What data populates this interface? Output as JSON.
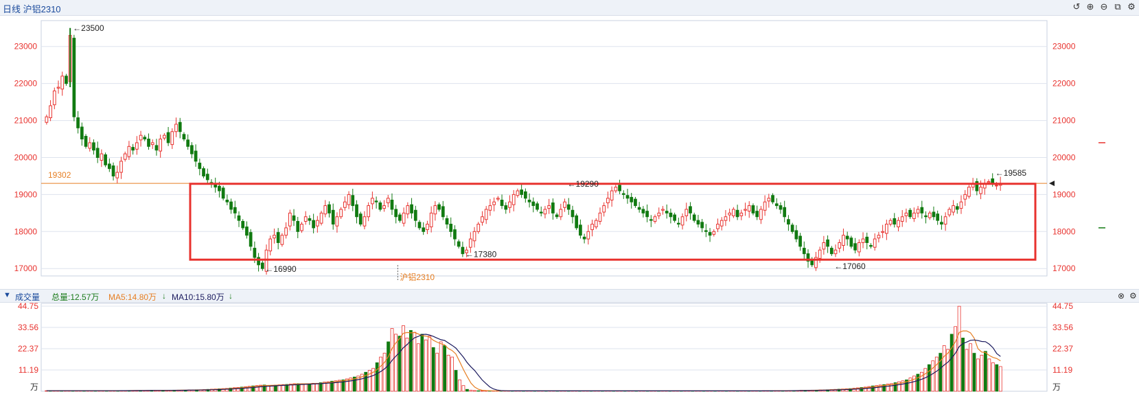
{
  "header": {
    "title": "日线 沪铝2310"
  },
  "toolbar": {
    "icons": [
      "undo-icon",
      "zoom-in-icon",
      "zoom-out-icon",
      "export-icon",
      "settings-icon"
    ]
  },
  "volume_bar": {
    "toggle_icon": "triangle-down-icon",
    "label": "成交量",
    "total": "总量:12.57万",
    "ma5": "MA5:14.80万",
    "ma10": "MA10:15.80万",
    "colors": {
      "label": "#1a4a9c",
      "total": "#1a7a1a",
      "ma5": "#e67e22",
      "ma10": "#1a1a5e"
    }
  },
  "colors": {
    "up": "#e8322e",
    "down": "#117a11",
    "axis_text": "#e8322e",
    "ref_line": "#e67e22",
    "box": "#e8322e",
    "grid": "#dde3ee"
  },
  "chart_data": [
    {
      "type": "candlestick",
      "title": "日线 沪铝2310",
      "ylim": [
        16800,
        23700
      ],
      "y_ticks": [
        17000,
        18000,
        19000,
        20000,
        21000,
        22000,
        23000
      ],
      "reference_line": {
        "value": 19302,
        "label": "19302"
      },
      "annotations": [
        {
          "label": "23500",
          "value": 23500
        },
        {
          "label": "19290",
          "value": 19290
        },
        {
          "label": "17380",
          "value": 17380
        },
        {
          "label": "16990",
          "value": 16990
        },
        {
          "label": "17060",
          "value": 17060
        },
        {
          "label": "19585",
          "value": 19585
        }
      ],
      "contract_label": "沪铝2310",
      "highlight_box": {
        "y_top": 19290,
        "y_bottom": 17240
      },
      "grid": true,
      "close_series": [
        21100,
        21400,
        21800,
        21900,
        22200,
        22000,
        23300,
        21100,
        20800,
        20500,
        20300,
        20400,
        20200,
        20000,
        20100,
        19800,
        19700,
        19500,
        19600,
        19900,
        20100,
        20300,
        20200,
        20400,
        20600,
        20500,
        20300,
        20400,
        20200,
        20500,
        20600,
        20400,
        20700,
        20900,
        20700,
        20500,
        20300,
        20100,
        19900,
        19700,
        19500,
        19400,
        19300,
        19200,
        19100,
        18900,
        18800,
        18600,
        18500,
        18300,
        18100,
        17900,
        17600,
        17300,
        17100,
        17000,
        17500,
        17800,
        17900,
        17700,
        17900,
        18100,
        18500,
        18300,
        18000,
        18200,
        18400,
        18300,
        18100,
        18300,
        18500,
        18700,
        18500,
        18200,
        18400,
        18600,
        18800,
        19000,
        18700,
        18400,
        18200,
        18400,
        18700,
        18900,
        18800,
        18600,
        18700,
        18900,
        18600,
        18400,
        18300,
        18500,
        18700,
        18500,
        18300,
        18100,
        18000,
        18200,
        18500,
        18700,
        18600,
        18400,
        18200,
        18000,
        17800,
        17600,
        17400,
        17500,
        17800,
        18000,
        18200,
        18400,
        18600,
        18700,
        18800,
        18900,
        18700,
        18600,
        18800,
        19000,
        19100,
        19000,
        18900,
        18800,
        18700,
        18600,
        18500,
        18600,
        18700,
        18500,
        18400,
        18600,
        18800,
        18600,
        18400,
        18100,
        17900,
        17800,
        18000,
        18200,
        18300,
        18500,
        18700,
        18900,
        19100,
        19200,
        19100,
        19000,
        18900,
        18800,
        18700,
        18600,
        18500,
        18400,
        18300,
        18400,
        18500,
        18600,
        18500,
        18400,
        18300,
        18200,
        18400,
        18600,
        18500,
        18300,
        18200,
        18100,
        18000,
        17900,
        18000,
        18200,
        18300,
        18400,
        18500,
        18600,
        18400,
        18500,
        18600,
        18700,
        18500,
        18400,
        18600,
        18800,
        18900,
        18800,
        18700,
        18600,
        18400,
        18200,
        18000,
        17800,
        17600,
        17400,
        17200,
        17100,
        17300,
        17500,
        17700,
        17600,
        17400,
        17500,
        17700,
        17900,
        17800,
        17600,
        17500,
        17700,
        17800,
        17700,
        17600,
        17800,
        17900,
        18000,
        18200,
        18300,
        18200,
        18300,
        18400,
        18500,
        18400,
        18500,
        18600,
        18500,
        18400,
        18500,
        18400,
        18300,
        18200,
        18400,
        18600,
        18700,
        18600,
        18800,
        19000,
        19200,
        19300,
        19100,
        19200,
        19300,
        19350,
        19300,
        19250,
        19300
      ],
      "series": [
        {
          "name": "成交量",
          "type": "bar",
          "values": [
            0.3,
            0.3,
            0.3,
            0.3,
            0.3,
            0.3,
            0.3,
            0.3,
            0.3,
            0.3,
            0.3,
            0.3,
            0.3,
            0.3,
            0.3,
            0.3,
            0.3,
            0.3,
            0.3,
            0.3,
            0.4,
            0.4,
            0.4,
            0.4,
            0.4,
            0.4,
            0.4,
            0.4,
            0.5,
            0.5,
            0.5,
            0.5,
            0.5,
            0.5,
            0.6,
            0.6,
            0.6,
            0.6,
            0.7,
            0.7,
            0.8,
            0.8,
            0.9,
            1.0,
            1.1,
            1.2,
            1.3,
            1.4,
            1.5,
            1.7,
            1.9,
            2.0,
            2.2,
            2.4,
            2.6,
            2.8,
            3.0,
            3.2,
            3.3,
            3.1,
            3.0,
            3.2,
            3.4,
            3.5,
            3.6,
            3.8,
            4.0,
            4.0,
            4.0,
            3.9,
            4.0,
            4.2,
            4.2,
            4.5,
            4.8,
            5.0,
            5.3,
            5.5,
            5.8,
            6.0,
            6.5,
            7.0,
            7.5,
            8.0,
            9.0,
            10.0,
            11.0,
            12.0,
            15.0,
            18.0,
            20.0,
            26.0,
            33.0,
            30.0,
            29.0,
            34.5,
            28.0,
            32.0,
            31.0,
            25.0,
            30.0,
            27.0,
            29.0,
            23.0,
            20.0,
            26.0,
            24.0,
            19.0,
            18.0,
            11.0,
            6.0,
            3.0,
            1.0,
            0.6,
            0.4,
            0.3,
            0.3,
            0.2,
            0.2,
            0.2,
            0.2,
            0.2,
            0.2,
            0.2,
            0.2,
            0.2,
            0.2,
            0.2,
            0.2,
            0.2,
            0.2,
            0.2,
            0.2,
            0.2,
            0.2,
            0.2,
            0.2,
            0.2,
            0.2,
            0.2,
            0.2,
            0.2,
            0.2,
            0.2,
            0.2,
            0.2,
            0.2,
            0.2,
            0.2,
            0.2,
            0.2,
            0.2,
            0.2,
            0.2,
            0.2,
            0.2,
            0.2,
            0.2,
            0.2,
            0.2,
            0.2,
            0.2,
            0.2,
            0.2,
            0.2,
            0.2,
            0.2,
            0.2,
            0.2,
            0.2,
            0.2,
            0.2,
            0.2,
            0.2,
            0.2,
            0.2,
            0.2,
            0.2,
            0.2,
            0.2,
            0.2,
            0.2,
            0.2,
            0.2,
            0.2,
            0.2,
            0.2,
            0.2,
            0.2,
            0.2,
            0.2,
            0.3,
            0.3,
            0.3,
            0.3,
            0.3,
            0.3,
            0.3,
            0.4,
            0.4,
            0.4,
            0.5,
            0.5,
            0.5,
            0.6,
            0.6,
            0.7,
            0.7,
            0.8,
            0.9,
            1.0,
            1.1,
            1.2,
            1.3,
            1.4,
            1.6,
            1.8,
            2.0,
            2.2,
            2.5,
            2.8,
            3.0,
            3.3,
            3.5,
            3.8,
            4.0,
            4.5,
            5.0,
            5.5,
            6.0,
            7.0,
            8.0,
            9.0,
            10.0,
            12.0,
            14.0,
            16.0,
            18.0,
            20.0,
            24.0,
            22.0,
            30.0,
            34.0,
            44.7,
            28.0,
            22.0,
            25.0,
            20.0,
            17.0,
            19.0,
            21.0,
            17.0,
            15.0,
            14.0,
            13.0
          ]
        },
        {
          "name": "MA5",
          "type": "line",
          "color": "#e67e22"
        },
        {
          "name": "MA10",
          "type": "line",
          "color": "#1a1a5e"
        }
      ],
      "y_ticks_vol": [
        "44.75",
        "33.56",
        "22.37",
        "11.19"
      ],
      "unit_label": "万",
      "ylim_vol": [
        0,
        44.75
      ]
    }
  ]
}
